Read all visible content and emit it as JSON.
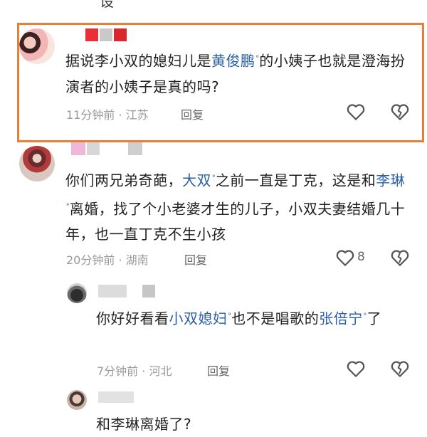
{
  "top_fragment": "设",
  "comments": [
    {
      "parts": [
        "据说李小双的媳妇儿是",
        "黄俊鹏",
        "的小姨子也就是澄海扮演者的小姨子是真的吗?"
      ],
      "time": "11分钟前",
      "location": "江苏",
      "reply_label": "回复",
      "likes": ""
    },
    {
      "parts": [
        "你们两兄弟奇葩，",
        "大双",
        "之前一直是丁克，这是和",
        "李琳",
        "离婚，找了个小老婆才生的儿子，小双夫妻结婚几十年，也一直丁克不生小孩"
      ],
      "time": "20分钟前",
      "location": "湖南",
      "reply_label": "回复",
      "likes": "8"
    },
    {
      "parts": [
        "你好好看看",
        "小双媳妇",
        "也不是唱歌的",
        "张倍宁",
        "了"
      ],
      "time": "7分钟前",
      "location": "河北",
      "reply_label": "回复",
      "likes": ""
    }
  ],
  "bottom_fragment": "和李琳离婚了?",
  "dot_separator": "·",
  "icons": {
    "like": "heart-icon",
    "dislike": "broken-heart-icon"
  },
  "colors": {
    "highlight": "#f07c2f",
    "link": "#2a5fa8"
  }
}
